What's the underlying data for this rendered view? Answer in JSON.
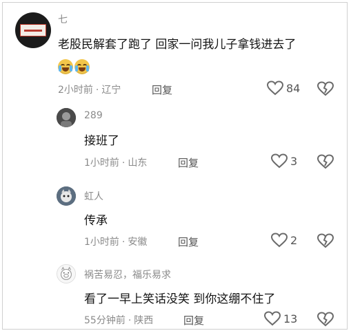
{
  "comments": [
    {
      "name": "七",
      "text": "老股民解套了跑了 回家一问我儿子拿钱进去了",
      "time": "2小时前",
      "location": "辽宁",
      "reply_label": "回复",
      "likes": "84",
      "emoji": [
        "loudly-crying-face",
        "loudly-crying-face"
      ]
    },
    {
      "name": "289",
      "text": "接班了",
      "time": "1小时前",
      "location": "山东",
      "reply_label": "回复",
      "likes": "3"
    },
    {
      "name": "虹人",
      "text": "传承",
      "time": "1小时前",
      "location": "安徽",
      "reply_label": "回复",
      "likes": "2"
    },
    {
      "name": "祸苦易忍，福乐易求",
      "text": "看了一早上笑话没笑 到你这绷不住了",
      "time": "55分钟前",
      "location": "陕西",
      "reply_label": "回复",
      "likes": "13"
    }
  ],
  "meta_separator": "·",
  "colors": {
    "meta": "#8a8a8a",
    "text": "#141414",
    "background": "#ffffff"
  }
}
